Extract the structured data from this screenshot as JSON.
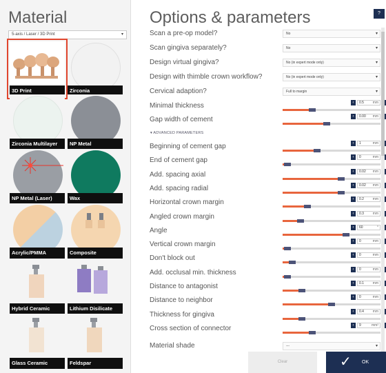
{
  "material": {
    "title": "Material",
    "select_value": "5-axis / Laser / 3D Print",
    "tiles": [
      {
        "label": "3D Print",
        "selected": true
      },
      {
        "label": "Zirconia"
      },
      {
        "label": "Zirconia Multilayer"
      },
      {
        "label": "NP Metal"
      },
      {
        "label": "NP Metal (Laser)"
      },
      {
        "label": "Wax"
      },
      {
        "label": "Acrylic/PMMA"
      },
      {
        "label": "Composite"
      },
      {
        "label": "Hybrid Ceramic"
      },
      {
        "label": "Lithium Disilicate"
      },
      {
        "label": "Glass Ceramic"
      },
      {
        "label": "Feldspar"
      }
    ]
  },
  "options": {
    "title": "Options & parameters",
    "help_label": "?",
    "dropdowns": [
      {
        "label": "Scan a pre-op model?",
        "value": "No"
      },
      {
        "label": "Scan gingiva separately?",
        "value": "No"
      },
      {
        "label": "Design virtual gingiva?",
        "value": "No (in expert mode only)"
      },
      {
        "label": "Design with thimble crown workflow?",
        "value": "No (in expert mode only)"
      },
      {
        "label": "Cervical adaption?",
        "value": "Full to margin"
      }
    ],
    "basic_params": [
      {
        "label": "Minimal thickness",
        "value": "0.5",
        "unit": "mm",
        "level": 0.3
      },
      {
        "label": "Gap width of cement",
        "value": "0.00",
        "unit": "mm",
        "level": 0.45
      }
    ],
    "advanced_label": "ADVANCED PARAMETERS",
    "advanced_params": [
      {
        "label": "Beginning of cement gap",
        "value": "1",
        "unit": "mm",
        "level": 0.35
      },
      {
        "label": "End of cement gap",
        "value": "0",
        "unit": "mm",
        "level": 0.05
      },
      {
        "label": "Add. spacing axial",
        "value": "0.02",
        "unit": "mm",
        "level": 0.6
      },
      {
        "label": "Add. spacing radial",
        "value": "0.02",
        "unit": "mm",
        "level": 0.6
      },
      {
        "label": "Horizontal crown margin",
        "value": "0.2",
        "unit": "mm",
        "level": 0.25
      },
      {
        "label": "Angled crown margin",
        "value": "0.3",
        "unit": "mm",
        "level": 0.18
      },
      {
        "label": "Angle",
        "value": "60",
        "unit": "°",
        "level": 0.65
      },
      {
        "label": "Vertical crown margin",
        "value": "0",
        "unit": "mm",
        "level": 0.05
      },
      {
        "label": "Don't block out",
        "value": "0",
        "unit": "mm",
        "level": 0.1
      },
      {
        "label": "Add. occlusal min. thickness",
        "value": "0",
        "unit": "mm",
        "level": 0.05
      },
      {
        "label": "Distance to antagonist",
        "value": "0.1",
        "unit": "mm",
        "level": 0.2
      },
      {
        "label": "Distance to neighbor",
        "value": "0",
        "unit": "mm",
        "level": 0.5
      },
      {
        "label": "Thickness for gingiva",
        "value": "0.4",
        "unit": "mm",
        "level": 0.2
      },
      {
        "label": "Cross section of connector",
        "value": "9",
        "unit": "mm²",
        "level": 0.3
      }
    ],
    "shade": {
      "label": "Material shade",
      "value": "---"
    }
  },
  "footer": {
    "clear_label": "Clear",
    "ok_label": "OK"
  },
  "colors": {
    "accent": "#e8653d",
    "navy": "#1d2f53",
    "selection": "#e0452d"
  }
}
